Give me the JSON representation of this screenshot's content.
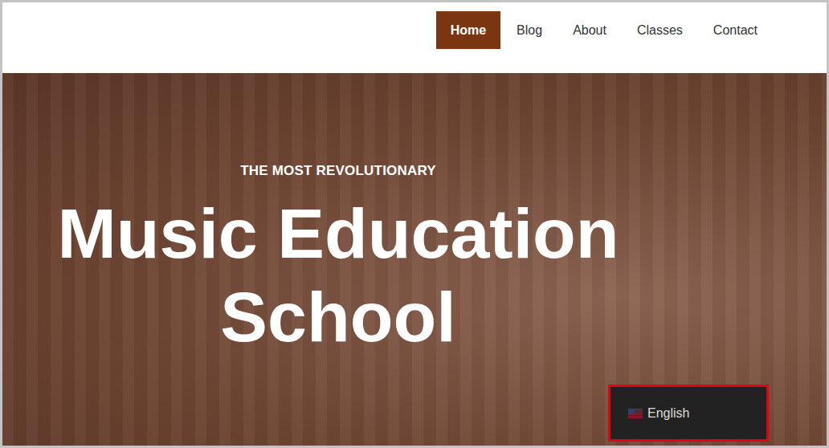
{
  "nav": [
    {
      "label": "Home",
      "selected": true
    },
    {
      "label": "Blog",
      "selected": false
    },
    {
      "label": "About",
      "selected": false
    },
    {
      "label": "Classes",
      "selected": false
    },
    {
      "label": "Contact",
      "selected": false
    }
  ],
  "hero": {
    "kicker": "THE MOST REVOLUTIONARY",
    "title_lines": [
      "Music Education",
      "School"
    ]
  },
  "language_switcher": {
    "label": "English",
    "highlighted": true
  }
}
